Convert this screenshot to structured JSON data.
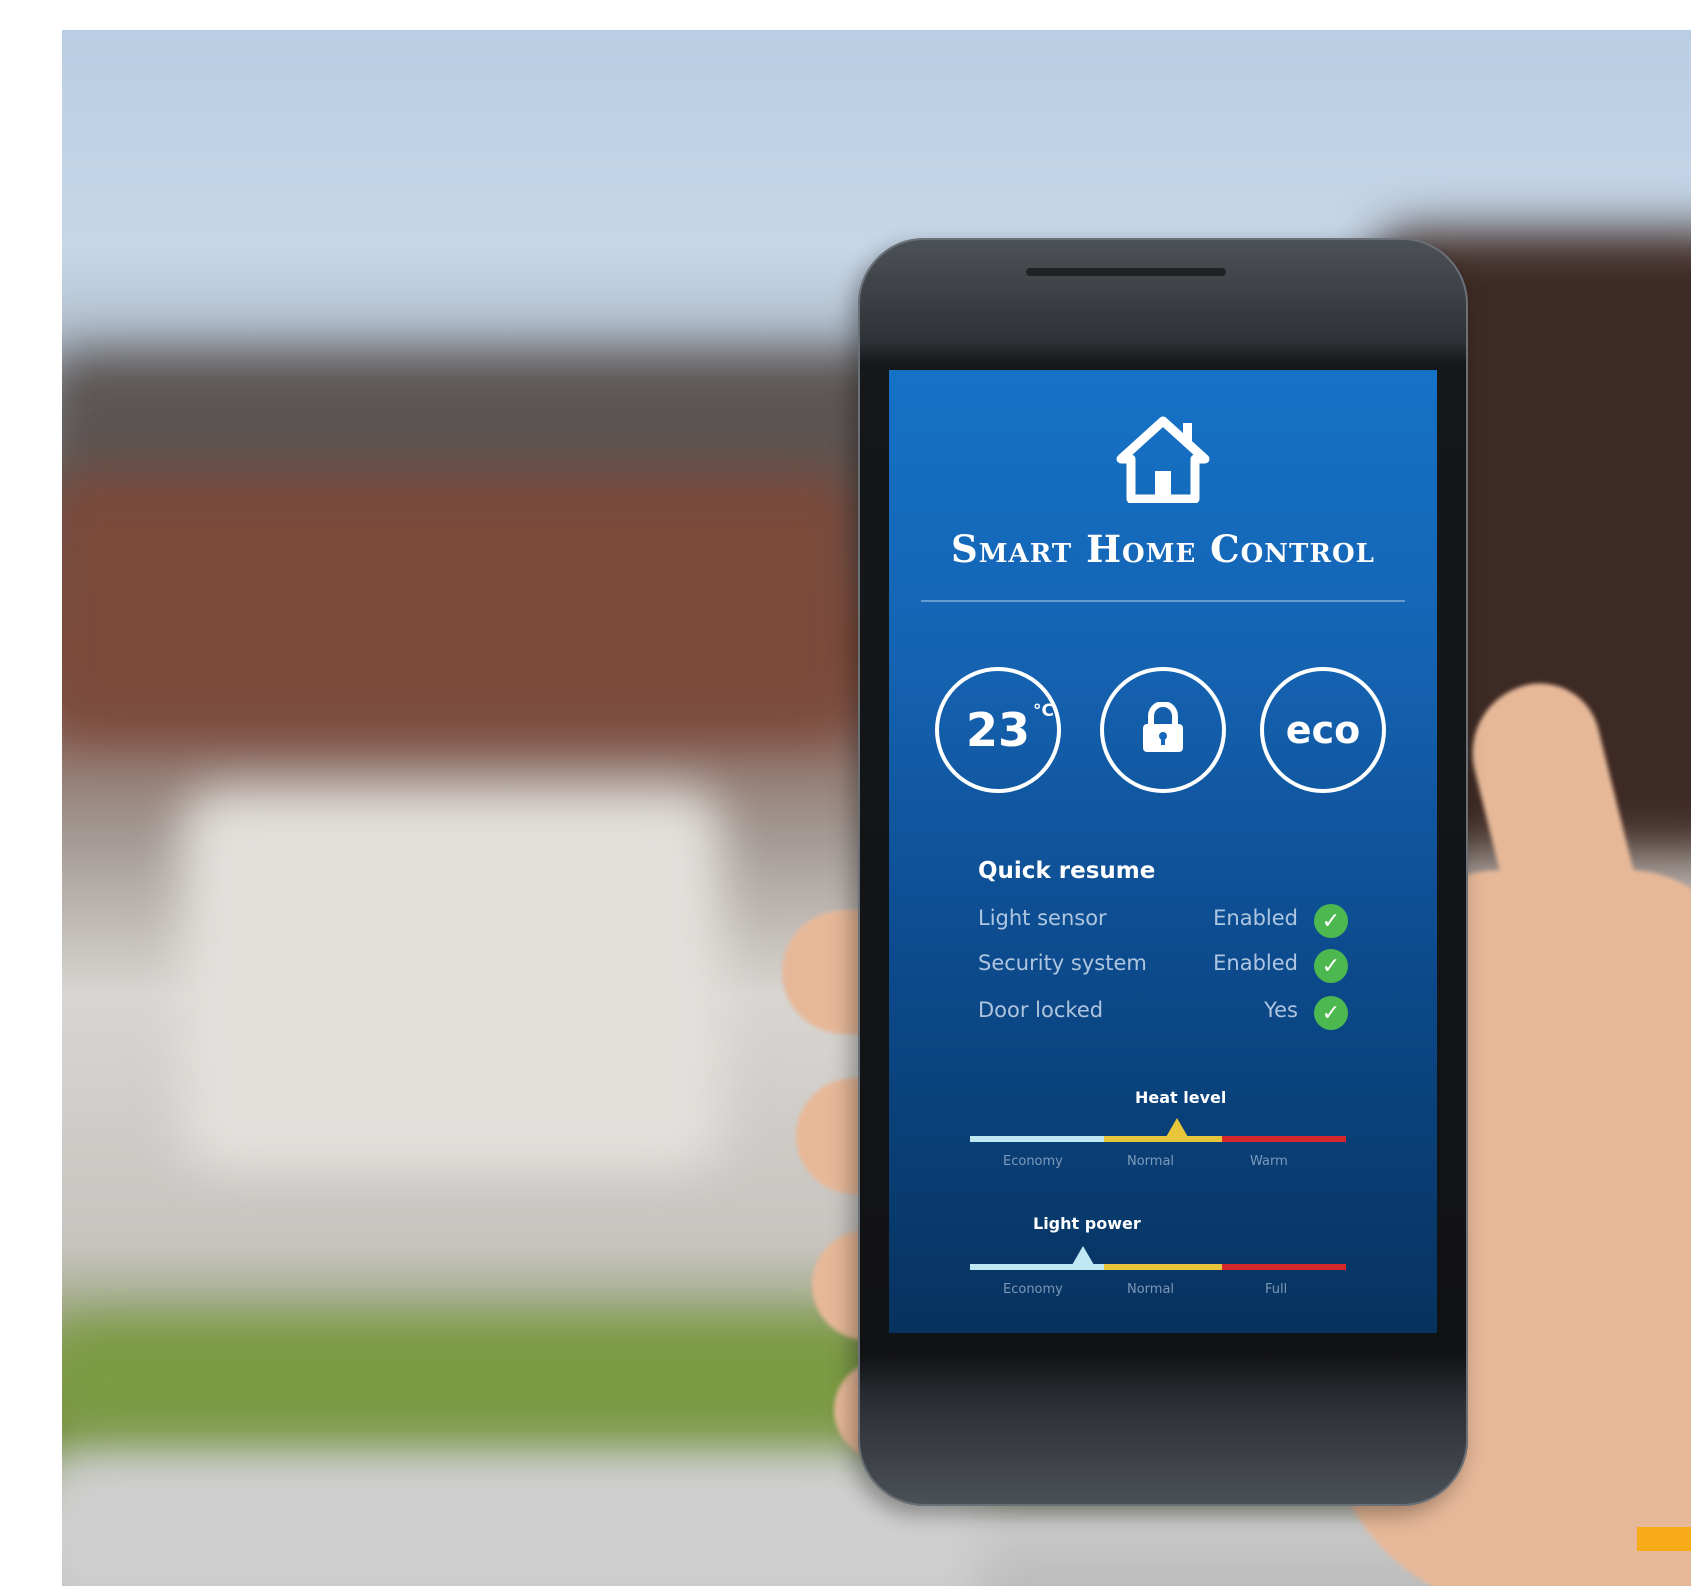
{
  "app": {
    "title": "Smart Home Control",
    "icon": "home-icon"
  },
  "status_buttons": [
    {
      "name": "temperature",
      "value": "23",
      "unit": "°C"
    },
    {
      "name": "lock",
      "icon": "lock-icon"
    },
    {
      "name": "eco",
      "label": "eco"
    }
  ],
  "quick_resume": {
    "title": "Quick resume",
    "items": [
      {
        "label": "Light sensor",
        "value": "Enabled",
        "status_icon": "check-icon"
      },
      {
        "label": "Security system",
        "value": "Enabled",
        "status_icon": "check-icon"
      },
      {
        "label": "Door locked",
        "value": "Yes",
        "status_icon": "check-icon"
      }
    ]
  },
  "sliders": [
    {
      "title": "Heat level",
      "ticks": [
        "Economy",
        "Normal",
        "Warm"
      ],
      "level_percent": 55
    },
    {
      "title": "Light power",
      "ticks": [
        "Economy",
        "Normal",
        "Full"
      ],
      "level_percent": 30
    }
  ],
  "colors": {
    "screen_blue": "#1572c7",
    "check_green": "#4cb84f",
    "economy": "#bfe8f4",
    "normal": "#e9c53a",
    "warm": "#d6282b",
    "accent": "#f7ac17"
  }
}
